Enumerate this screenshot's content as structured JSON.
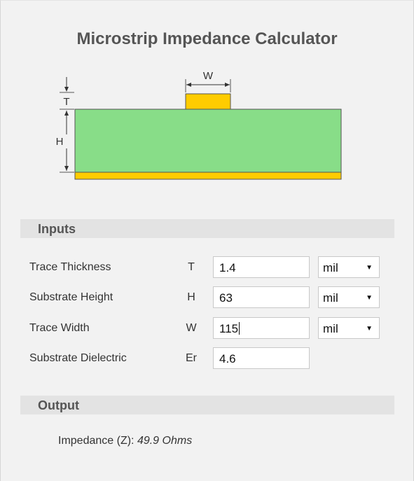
{
  "title": "Microstrip Impedance Calculator",
  "diagram": {
    "label_w": "W",
    "label_t": "T",
    "label_h": "H",
    "colors": {
      "substrate": "#88dd88",
      "copper": "#ffcc00",
      "outline": "#555555"
    }
  },
  "inputs_section": {
    "heading": "Inputs",
    "rows": [
      {
        "label": "Trace Thickness",
        "symbol": "T",
        "value": "1.4",
        "unit": "mil",
        "icon": "chevron-down-icon"
      },
      {
        "label": "Substrate Height",
        "symbol": "H",
        "value": "63",
        "unit": "mil",
        "icon": "chevron-down-icon"
      },
      {
        "label": "Trace Width",
        "symbol": "W",
        "value": "115",
        "unit": "mil",
        "icon": "chevron-down-icon"
      },
      {
        "label": "Substrate Dielectric",
        "symbol": "Er",
        "value": "4.6"
      }
    ]
  },
  "output_section": {
    "heading": "Output",
    "impedance_label": "Impedance (Z):",
    "impedance_value": "49.9 Ohms"
  }
}
